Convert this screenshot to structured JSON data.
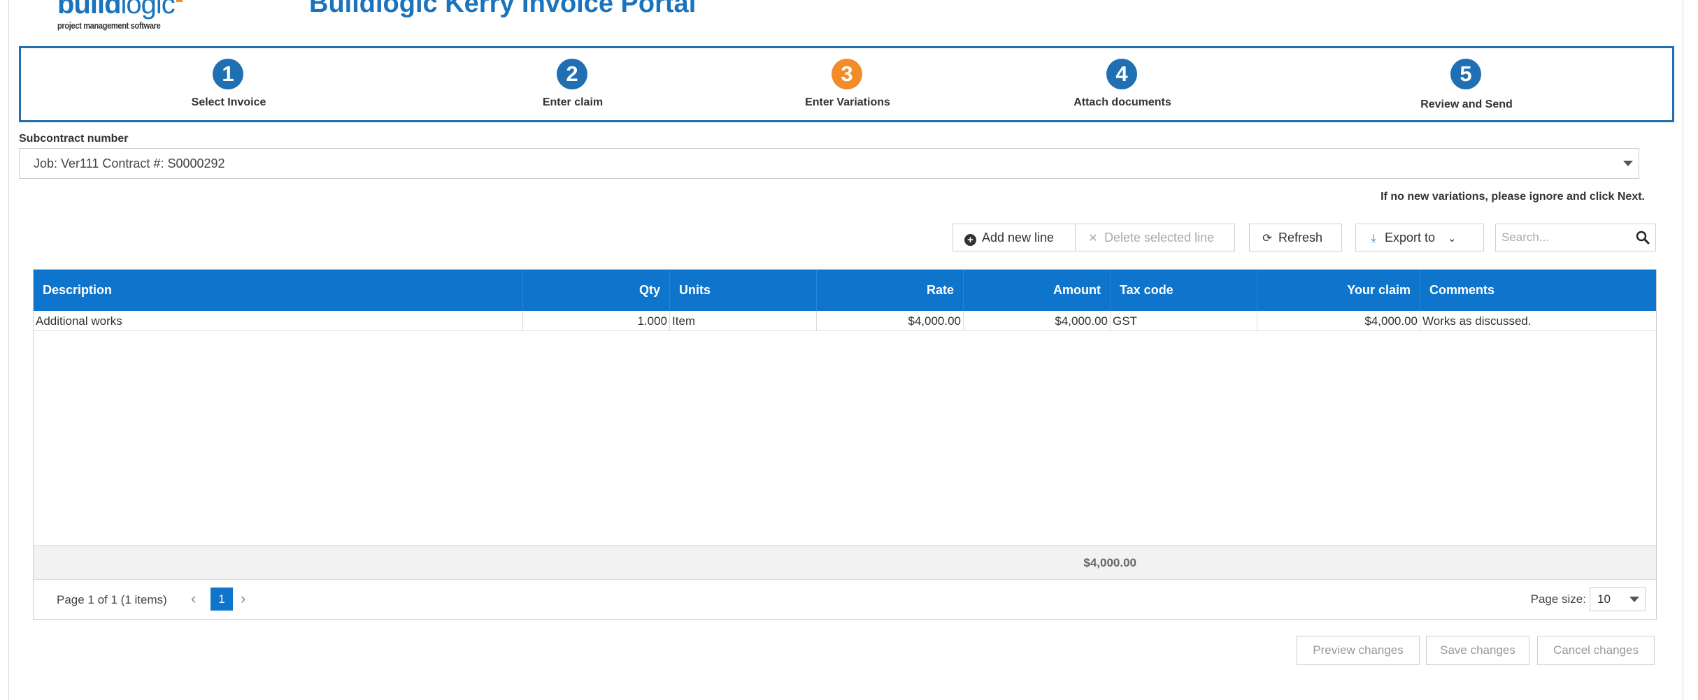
{
  "header": {
    "logo_main_bold": "build",
    "logo_main_light": "logic",
    "logo_sub": "project management software",
    "title": "Buildlogic Kerry Invoice Portal"
  },
  "wizard": {
    "steps": [
      {
        "number": "1",
        "label": "Select Invoice",
        "state": "complete"
      },
      {
        "number": "2",
        "label": "Enter claim",
        "state": "complete"
      },
      {
        "number": "3",
        "label": "Enter Variations",
        "state": "active"
      },
      {
        "number": "4",
        "label": "Attach documents",
        "state": "pending"
      },
      {
        "number": "5",
        "label": "Review and Send",
        "state": "pending"
      }
    ],
    "active_color": "#f28c28",
    "step_color": "#1f6fb2"
  },
  "subcontract": {
    "label": "Subcontract number",
    "value": "Job: Ver111 Contract #: S0000292"
  },
  "hint": "If no new variations, please ignore and click Next.",
  "toolbar": {
    "add_label": "Add new line",
    "delete_label": "Delete selected line",
    "refresh_label": "Refresh",
    "export_label": "Export to",
    "search_placeholder": "Search..."
  },
  "grid": {
    "columns": [
      "Description",
      "Qty",
      "Units",
      "Rate",
      "Amount",
      "Tax code",
      "Your claim",
      "Comments"
    ],
    "rows": [
      [
        "Additional works",
        "1.000",
        "Item",
        "$4,000.00",
        "$4,000.00",
        "GST",
        "$4,000.00",
        "Works as discussed."
      ]
    ],
    "footer_total": "$4,000.00",
    "header_color": "#0f74cc"
  },
  "pager": {
    "info": "Page 1 of 1 (1 items)",
    "current_page": "1",
    "page_size_label": "Page size:",
    "page_size": "10"
  },
  "actions": {
    "preview": "Preview changes",
    "save": "Save changes",
    "cancel": "Cancel changes"
  }
}
